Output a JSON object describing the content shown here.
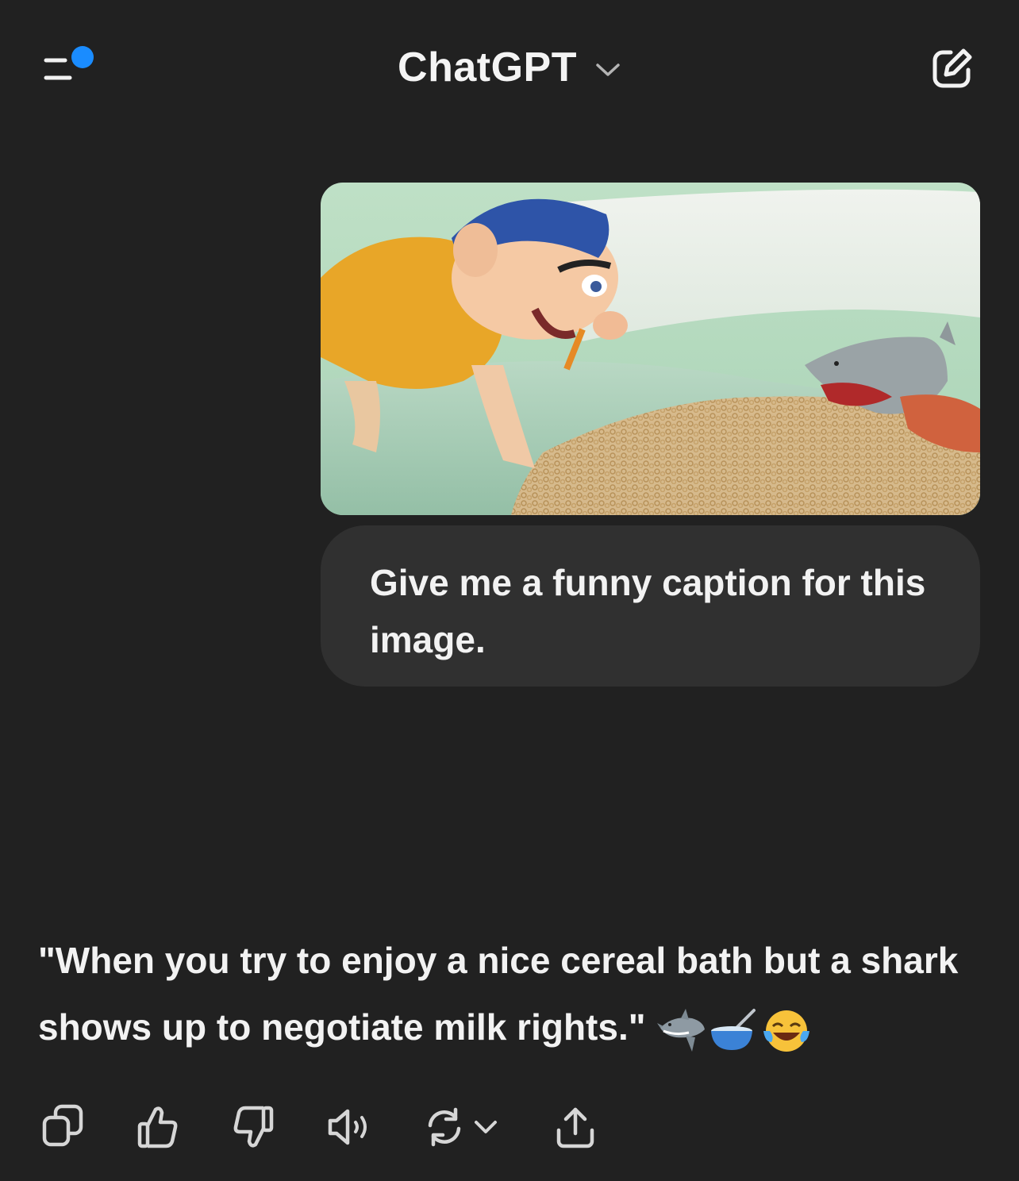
{
  "header": {
    "title": "ChatGPT",
    "menu_icon": "sidebar-menu-icon",
    "title_chevron_icon": "chevron-down-icon",
    "new_chat_icon": "compose-icon",
    "notification_dot_color": "#1a8cff"
  },
  "user_message": {
    "image_description_icon": "attached-image",
    "text": "Give me a funny caption for this image."
  },
  "assistant_message": {
    "text": "\"When you try to enjoy a nice cereal bath but a shark shows up to negotiate milk rights.\"",
    "emojis": [
      "shark-emoji",
      "bowl-with-spoon-emoji",
      "tears-of-joy-emoji"
    ]
  },
  "actions": {
    "items": [
      {
        "name": "copy",
        "icon": "copy-icon"
      },
      {
        "name": "thumbs-up",
        "icon": "thumbs-up-icon"
      },
      {
        "name": "thumbs-down",
        "icon": "thumbs-down-icon"
      },
      {
        "name": "read-aloud",
        "icon": "speaker-icon"
      },
      {
        "name": "regenerate",
        "icon": "regenerate-icon"
      },
      {
        "name": "share",
        "icon": "share-icon"
      }
    ]
  },
  "colors": {
    "background": "#212121",
    "bubble": "#303030",
    "text": "#f2f2f2",
    "accent": "#1a8cff"
  }
}
